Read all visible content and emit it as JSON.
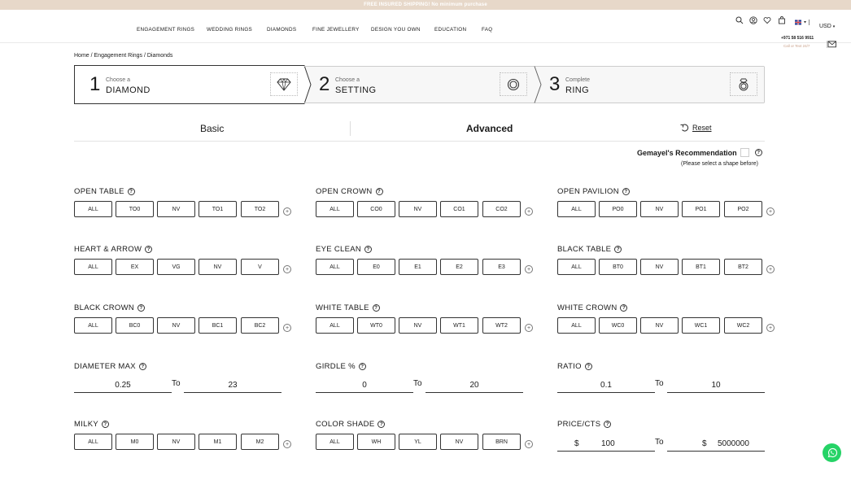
{
  "promo": "FREE INSURED SHIPPING! No minimum purchase",
  "nav": [
    "ENGAGEMENT RINGS",
    "WEDDING RINGS",
    "DIAMONDS",
    "FINE JEWELLERY",
    "DESIGN YOU OWN",
    "EDUCATION",
    "FAQ"
  ],
  "header": {
    "currency": "USD",
    "phone": "+971 58 516 9911",
    "call_text": "Call or Text 24/7",
    "icons": [
      "search-icon",
      "account-icon",
      "heart-icon",
      "bag-icon",
      "flag-icon"
    ]
  },
  "breadcrumb": "Home / Engagement Rings / Diamonds",
  "steps": [
    {
      "num": "1",
      "top": "Choose a",
      "main": "DIAMOND",
      "icon": "diamond-icon"
    },
    {
      "num": "2",
      "top": "Choose a",
      "main": "SETTING",
      "icon": "ring-setting-icon"
    },
    {
      "num": "3",
      "top": "Complete",
      "main": "RING",
      "icon": "ring-icon"
    }
  ],
  "tabs": {
    "basic": "Basic",
    "advanced": "Advanced",
    "reset": "Reset"
  },
  "recommendation": {
    "label": "Gemayel's Recommendation",
    "hint": "(Please select a shape before)"
  },
  "filters": {
    "open_table": {
      "title": "OPEN TABLE",
      "options": [
        "ALL",
        "TO0",
        "NV",
        "TO1",
        "TO2"
      ]
    },
    "open_crown": {
      "title": "OPEN CROWN",
      "options": [
        "ALL",
        "CO0",
        "NV",
        "CO1",
        "CO2"
      ]
    },
    "open_pavilion": {
      "title": "OPEN PAVILION",
      "options": [
        "ALL",
        "PO0",
        "NV",
        "PO1",
        "PO2"
      ]
    },
    "heart_arrow": {
      "title": "HEART & ARROW",
      "options": [
        "ALL",
        "EX",
        "VG",
        "NV",
        "V"
      ]
    },
    "eye_clean": {
      "title": "EYE CLEAN",
      "options": [
        "ALL",
        "E0",
        "E1",
        "E2",
        "E3"
      ]
    },
    "black_table": {
      "title": "BLACK TABLE",
      "options": [
        "ALL",
        "BT0",
        "NV",
        "BT1",
        "BT2"
      ]
    },
    "black_crown": {
      "title": "BLACK CROWN",
      "options": [
        "ALL",
        "BC0",
        "NV",
        "BC1",
        "BC2"
      ]
    },
    "white_table": {
      "title": "WHITE TABLE",
      "options": [
        "ALL",
        "WT0",
        "NV",
        "WT1",
        "WT2"
      ]
    },
    "white_crown": {
      "title": "WHITE CROWN",
      "options": [
        "ALL",
        "WC0",
        "NV",
        "WC1",
        "WC2"
      ]
    },
    "milky": {
      "title": "MILKY",
      "options": [
        "ALL",
        "M0",
        "NV",
        "M1",
        "M2"
      ]
    },
    "color_shade": {
      "title": "COLOR SHADE",
      "options": [
        "ALL",
        "WH",
        "YL",
        "NV",
        "BRN"
      ]
    }
  },
  "ranges": {
    "diameter_max": {
      "title": "DIAMETER MAX",
      "from": "0.25",
      "to_label": "To",
      "to": "23"
    },
    "girdle": {
      "title": "GIRDLE %",
      "from": "0",
      "to_label": "To",
      "to": "20"
    },
    "ratio": {
      "title": "RATIO",
      "from": "0.1",
      "to_label": "To",
      "to": "10"
    },
    "price_cts": {
      "title": "PRICE/CTS",
      "currency": "$",
      "from": "100",
      "to_label": "To",
      "to": "5000000"
    }
  }
}
